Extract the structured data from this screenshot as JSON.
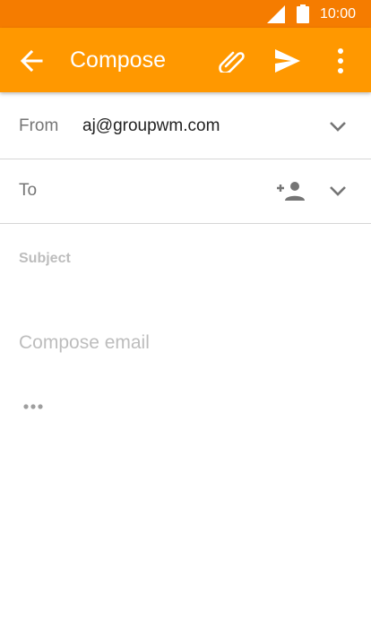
{
  "status_bar": {
    "time": "10:00",
    "icons": [
      "signal-icon",
      "battery-icon"
    ]
  },
  "app_bar": {
    "title": "Compose",
    "color": "#ff9800",
    "status_color": "#f57c00",
    "icons": [
      "back-arrow-icon",
      "attach-icon",
      "send-icon",
      "more-vert-icon"
    ]
  },
  "from": {
    "label": "From",
    "value": "aj@groupwm.com"
  },
  "to": {
    "label": "To"
  },
  "subject": {
    "placeholder": "Subject"
  },
  "body": {
    "placeholder": "Compose email"
  }
}
